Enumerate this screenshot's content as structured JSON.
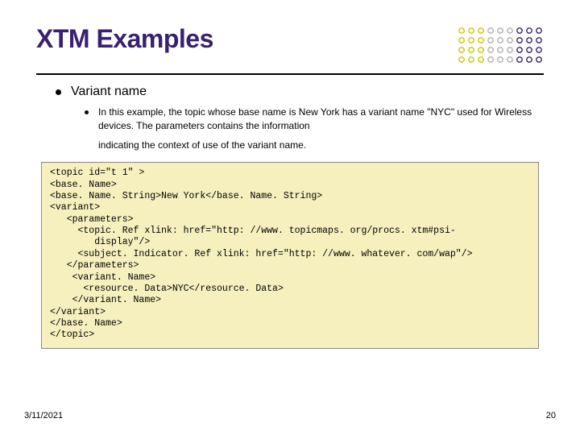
{
  "title": "XTM Examples",
  "bullet1": "Variant name",
  "bullet2_p1": "In this example, the topic whose base name is New York has a variant name \"NYC\" used for Wireless devices. The parameters contains the information",
  "bullet2_p2": "indicating the context of use of the variant name.",
  "code": "<topic id=\"t 1\" >\n<base. Name>\n<base. Name. String>New York</base. Name. String>\n<variant>\n   <parameters>\n     <topic. Ref xlink: href=\"http: //www. topicmaps. org/procs. xtm#psi-\n        display\"/>\n     <subject. Indicator. Ref xlink: href=\"http: //www. whatever. com/wap\"/>\n   </parameters>\n    <variant. Name>\n      <resource. Data>NYC</resource. Data>\n    </variant. Name>\n</variant>\n</base. Name>\n</topic>",
  "footer_date": "3/11/2021",
  "footer_page": "20",
  "deco": {
    "colors": [
      "#c9c900",
      "#afafaf",
      "#3a2070"
    ]
  }
}
